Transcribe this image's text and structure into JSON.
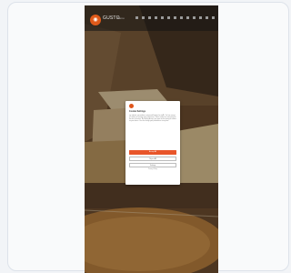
{
  "app": {
    "brand": "GUSTO",
    "nav_link": "Menu"
  },
  "consent_dialog": {
    "title": "Cookie Settings",
    "body": "We use cookies and similar technologies to improve your experience on our website, personalize content and analyze our traffic. You can accept all cookies or manage your preferences. Some cookies are necessary for the site to function. By clicking Accept, you agree to the storing of cookies on your device. You can change your preferences at any time.",
    "accept_label": "Accept All",
    "reject_label": "Reject All",
    "settings_label": "Settings",
    "policy_link": "Privacy Policy"
  },
  "colors": {
    "accent": "#e8552a",
    "logo": "#e0561c"
  }
}
